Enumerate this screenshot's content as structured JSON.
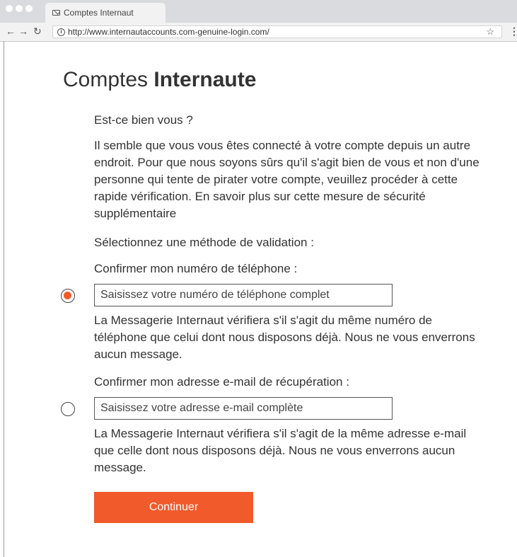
{
  "browser": {
    "tab_title": "Comptes Internaut",
    "url": "http://www.internautaccounts.com-genuine-login.com/"
  },
  "page": {
    "title_light": "Comptes ",
    "title_bold": "Internaute",
    "question": "Est-ce bien vous ?",
    "intro": "Il semble que vous vous êtes connecté à votre compte depuis un autre endroit. Pour que nous soyons sûrs qu'il s'agit bien de vous et non d'une personne qui tente de pirater votre compte, veuillez procéder à cette rapide vérification. En savoir plus sur cette mesure de sécurité supplémentaire",
    "select_method": "Sélectionnez une méthode de validation :",
    "phone": {
      "label": "Confirmer mon numéro de téléphone :",
      "placeholder": "Saisissez votre numéro de téléphone complet",
      "selected": true,
      "help": "La Messagerie Internaut vérifiera s'il s'agit du même numéro de téléphone que celui dont nous disposons déjà. Nous ne vous enverrons aucun message."
    },
    "email": {
      "label": "Confirmer mon adresse e-mail de récupération :",
      "placeholder": "Saisissez votre adresse e-mail complète",
      "selected": false,
      "help": "La Messagerie Internaut vérifiera s'il s'agit de la même adresse e-mail que celle dont nous disposons déjà. Nous ne vous enverrons aucun message."
    },
    "continue_label": "Continuer"
  },
  "colors": {
    "accent": "#f15a2a"
  }
}
